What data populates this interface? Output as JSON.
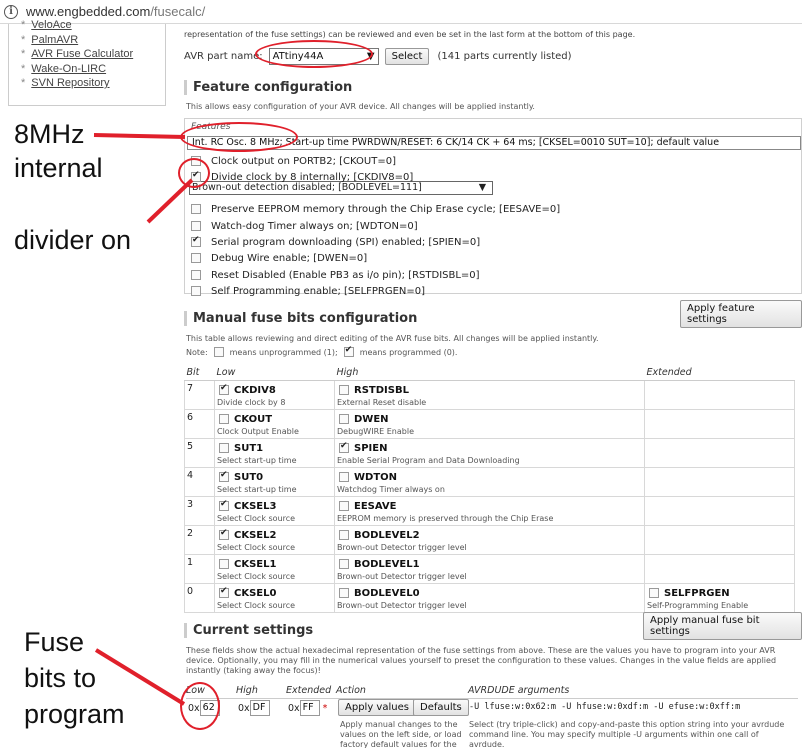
{
  "browser": {
    "url_host": "www.engbedded.com",
    "url_path": "/fusecalc/"
  },
  "sidebar": {
    "items": [
      "VeloAce",
      "PalmAVR",
      "AVR Fuse Calculator",
      "Wake-On-LIRC",
      "SVN Repository"
    ]
  },
  "top_text": "representation of the fuse settings) can be reviewed and even be set in the last form at the bottom of this page.",
  "part": {
    "label": "AVR part name:",
    "selected": "ATtiny44A",
    "select_button": "Select",
    "count_text": "(141 parts currently listed)"
  },
  "feature_config": {
    "heading": "Feature configuration",
    "note": "This allows easy configuration of your AVR device. All changes will be applied instantly.",
    "legend": "Features",
    "clock_select": "Int. RC Osc. 8 MHz; Start-up time PWRDWN/RESET: 6 CK/14 CK + 64 ms; [CKSEL=0010 SUT=10]; default value",
    "bod_select": "Brown-out detection disabled; [BODLEVEL=111]",
    "items": [
      {
        "label": "Clock output on PORTB2; [CKOUT=0]",
        "checked": false
      },
      {
        "label": "Divide clock by 8 internally; [CKDIV8=0]",
        "checked": true
      },
      {
        "label": "Preserve EEPROM memory through the Chip Erase cycle; [EESAVE=0]",
        "checked": false
      },
      {
        "label": "Watch-dog Timer always on; [WDTON=0]",
        "checked": false
      },
      {
        "label": "Serial program downloading (SPI) enabled; [SPIEN=0]",
        "checked": true
      },
      {
        "label": "Debug Wire enable; [DWEN=0]",
        "checked": false
      },
      {
        "label": "Reset Disabled (Enable PB3 as i/o pin); [RSTDISBL=0]",
        "checked": false
      },
      {
        "label": "Self Programming enable; [SELFPRGEN=0]",
        "checked": false
      }
    ],
    "apply_button": "Apply feature settings"
  },
  "manual": {
    "heading": "Manual fuse bits configuration",
    "note1": "This table allows reviewing and direct editing of the AVR fuse bits. All changes will be applied instantly.",
    "note2_a": "Note:",
    "note2_b": "means unprogrammed (1);",
    "note2_c": "means programmed (0).",
    "headers": {
      "bit": "Bit",
      "low": "Low",
      "high": "High",
      "ext": "Extended"
    },
    "rows": [
      {
        "bit": "7",
        "low": {
          "name": "CKDIV8",
          "desc": "Divide clock by 8",
          "checked": true
        },
        "high": {
          "name": "RSTDISBL",
          "desc": "External Reset disable",
          "checked": false
        },
        "ext": null
      },
      {
        "bit": "6",
        "low": {
          "name": "CKOUT",
          "desc": "Clock Output Enable",
          "checked": false
        },
        "high": {
          "name": "DWEN",
          "desc": "DebugWIRE Enable",
          "checked": false
        },
        "ext": null
      },
      {
        "bit": "5",
        "low": {
          "name": "SUT1",
          "desc": "Select start-up time",
          "checked": false
        },
        "high": {
          "name": "SPIEN",
          "desc": "Enable Serial Program and Data Downloading",
          "checked": true
        },
        "ext": null
      },
      {
        "bit": "4",
        "low": {
          "name": "SUT0",
          "desc": "Select start-up time",
          "checked": true
        },
        "high": {
          "name": "WDTON",
          "desc": "Watchdog Timer always on",
          "checked": false
        },
        "ext": null
      },
      {
        "bit": "3",
        "low": {
          "name": "CKSEL3",
          "desc": "Select Clock source",
          "checked": true
        },
        "high": {
          "name": "EESAVE",
          "desc": "EEPROM memory is preserved through the Chip Erase",
          "checked": false
        },
        "ext": null
      },
      {
        "bit": "2",
        "low": {
          "name": "CKSEL2",
          "desc": "Select Clock source",
          "checked": true
        },
        "high": {
          "name": "BODLEVEL2",
          "desc": "Brown-out Detector trigger level",
          "checked": false
        },
        "ext": null
      },
      {
        "bit": "1",
        "low": {
          "name": "CKSEL1",
          "desc": "Select Clock source",
          "checked": false
        },
        "high": {
          "name": "BODLEVEL1",
          "desc": "Brown-out Detector trigger level",
          "checked": false
        },
        "ext": null
      },
      {
        "bit": "0",
        "low": {
          "name": "CKSEL0",
          "desc": "Select Clock source",
          "checked": true
        },
        "high": {
          "name": "BODLEVEL0",
          "desc": "Brown-out Detector trigger level",
          "checked": false
        },
        "ext": {
          "name": "SELFPRGEN",
          "desc": "Self-Programming Enable",
          "checked": false
        }
      }
    ],
    "apply_button": "Apply manual fuse bit settings"
  },
  "current": {
    "heading": "Current settings",
    "note": "These fields show the actual hexadecimal representation of the fuse settings from above. These are the values you have to program into your AVR device. Optionally, you may fill in the numerical values yourself to preset the configuration to these values. Changes in the value fields are applied instantly (taking away the focus)!",
    "headers": {
      "low": "Low",
      "high": "High",
      "ext": "Extended",
      "action": "Action",
      "avrdude": "AVRDUDE arguments"
    },
    "prefix": "0x",
    "low_value": "62",
    "high_value": "DF",
    "ext_value": "FF",
    "asterisk": "*",
    "apply_values_button": "Apply values",
    "defaults_button": "Defaults",
    "action_note": "Apply manual changes to the values on the left side, or load factory default values for the",
    "avrdude_args": "-U lfuse:w:0x62:m -U hfuse:w:0xdf:m -U efuse:w:0xff:m",
    "avrdude_note": "Select (try triple-click) and copy-and-paste this option string into your avrdude command line. You may specify multiple -U arguments within one call of avrdude."
  },
  "annotations": {
    "eight_mhz": "8MHz",
    "internal": "internal",
    "divider": "divider on",
    "fuse_l1": "Fuse",
    "fuse_l2": "bits to",
    "fuse_l3": "program"
  },
  "colors": {
    "annotation_red": "#e0202b"
  }
}
